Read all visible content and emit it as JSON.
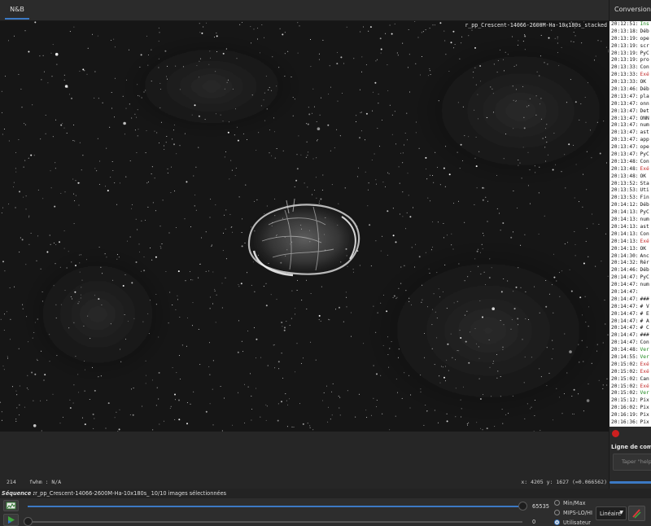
{
  "tabs": {
    "left_active": "N&B",
    "right_active": "Conversion"
  },
  "viewer": {
    "filename": "r_pp_Crescent-14066-2600M-Ha-10x180s_stacked"
  },
  "log": [
    {
      "time": "20:12:51:",
      "msg": "Ins",
      "color": "#1f8a1f"
    },
    {
      "time": "20:13:18:",
      "msg": "Déb",
      "color": "#111111"
    },
    {
      "time": "20:13:19:",
      "msg": "ope",
      "color": "#111111"
    },
    {
      "time": "20:13:19:",
      "msg": "scr",
      "color": "#111111"
    },
    {
      "time": "20:13:19:",
      "msg": "PyC",
      "color": "#111111"
    },
    {
      "time": "20:13:19:",
      "msg": "pro",
      "color": "#111111"
    },
    {
      "time": "20:13:33:",
      "msg": "Con",
      "color": "#111111"
    },
    {
      "time": "20:13:33:",
      "msg": "Exé",
      "color": "#c22a2a"
    },
    {
      "time": "20:13:33:",
      "msg": "OK",
      "color": "#111111"
    },
    {
      "time": "20:13:46:",
      "msg": "Déb",
      "color": "#111111"
    },
    {
      "time": "20:13:47:",
      "msg": "pla",
      "color": "#111111"
    },
    {
      "time": "20:13:47:",
      "msg": "onn",
      "color": "#111111"
    },
    {
      "time": "20:13:47:",
      "msg": "Det",
      "color": "#111111"
    },
    {
      "time": "20:13:47:",
      "msg": "ONN",
      "color": "#111111"
    },
    {
      "time": "20:13:47:",
      "msg": "num",
      "color": "#111111"
    },
    {
      "time": "20:13:47:",
      "msg": "ast",
      "color": "#111111"
    },
    {
      "time": "20:13:47:",
      "msg": "app",
      "color": "#111111"
    },
    {
      "time": "20:13:47:",
      "msg": "ope",
      "color": "#111111"
    },
    {
      "time": "20:13:47:",
      "msg": "PyC",
      "color": "#111111"
    },
    {
      "time": "20:13:48:",
      "msg": "Con",
      "color": "#111111"
    },
    {
      "time": "20:13:48:",
      "msg": "Exé",
      "color": "#c22a2a"
    },
    {
      "time": "20:13:48:",
      "msg": "OK",
      "color": "#111111"
    },
    {
      "time": "20:13:52:",
      "msg": "Sta",
      "color": "#111111"
    },
    {
      "time": "20:13:53:",
      "msg": "Uti",
      "color": "#111111"
    },
    {
      "time": "20:13:53:",
      "msg": "Fin",
      "color": "#111111"
    },
    {
      "time": "20:14:12:",
      "msg": "Déb",
      "color": "#111111"
    },
    {
      "time": "20:14:13:",
      "msg": "PyC",
      "color": "#111111"
    },
    {
      "time": "20:14:13:",
      "msg": "num",
      "color": "#111111"
    },
    {
      "time": "20:14:13:",
      "msg": "ast",
      "color": "#111111"
    },
    {
      "time": "20:14:13:",
      "msg": "Con",
      "color": "#111111"
    },
    {
      "time": "20:14:13:",
      "msg": "Exé",
      "color": "#c22a2a"
    },
    {
      "time": "20:14:13:",
      "msg": "OK",
      "color": "#111111"
    },
    {
      "time": "20:14:30:",
      "msg": "Anc",
      "color": "#111111"
    },
    {
      "time": "20:14:32:",
      "msg": "Rér",
      "color": "#111111"
    },
    {
      "time": "20:14:46:",
      "msg": "Déb",
      "color": "#111111"
    },
    {
      "time": "20:14:47:",
      "msg": "PyC",
      "color": "#111111"
    },
    {
      "time": "20:14:47:",
      "msg": "num",
      "color": "#111111"
    },
    {
      "time": "20:14:47:",
      "msg": "",
      "color": "#111111"
    },
    {
      "time": "20:14:47:",
      "msg": "###",
      "color": "#111111"
    },
    {
      "time": "20:14:47:",
      "msg": "# V",
      "color": "#111111"
    },
    {
      "time": "20:14:47:",
      "msg": "# E",
      "color": "#111111"
    },
    {
      "time": "20:14:47:",
      "msg": "# A",
      "color": "#111111"
    },
    {
      "time": "20:14:47:",
      "msg": "# C",
      "color": "#111111"
    },
    {
      "time": "20:14:47:",
      "msg": "###",
      "color": "#111111"
    },
    {
      "time": "20:14:47:",
      "msg": "Con",
      "color": "#111111"
    },
    {
      "time": "20:14:48:",
      "msg": "Ver",
      "color": "#1f8a1f"
    },
    {
      "time": "20:14:55:",
      "msg": "Ver",
      "color": "#1f8a1f"
    },
    {
      "time": "20:15:02:",
      "msg": "Exé",
      "color": "#c22a2a"
    },
    {
      "time": "20:15:02:",
      "msg": "Exé",
      "color": "#c22a2a"
    },
    {
      "time": "20:15:02:",
      "msg": "Can",
      "color": "#111111"
    },
    {
      "time": "20:15:02:",
      "msg": "Exé",
      "color": "#c22a2a"
    },
    {
      "time": "20:15:02:",
      "msg": "Ver",
      "color": "#1f8a1f"
    },
    {
      "time": "20:15:12:",
      "msg": "Pix",
      "color": "#111111"
    },
    {
      "time": "20:16:02:",
      "msg": "Pix",
      "color": "#111111"
    },
    {
      "time": "20:16:19:",
      "msg": "Pix",
      "color": "#111111"
    },
    {
      "time": "20:16:36:",
      "msg": "Pix",
      "color": "#111111"
    }
  ],
  "command": {
    "label": "Ligne de comma",
    "placeholder": "Taper \"help\""
  },
  "info": {
    "count": "214",
    "fwhm": "fwhm : N/A",
    "coords": "x: 4205 y: 1627 (=0.066562)"
  },
  "sequence": {
    "label": "Séquence :",
    "text": "r_pp_Crescent-14066-2600M-Ha-10x180s_ 10/10 images sélectionnées"
  },
  "sliders": {
    "hi_value": "65535",
    "lo_value": "0"
  },
  "modes": {
    "minmax": "Min/Max",
    "mips": "MIPS-LO/HI",
    "user": "Utilisateur",
    "selected": "user"
  },
  "scale": {
    "selected": "Linéaire"
  },
  "colors": {
    "accent": "#3c79c4",
    "error": "#c22a2a",
    "success": "#1f8a1f",
    "record": "#cc1f1f"
  },
  "icons": {
    "histogram": "histogram-icon",
    "play": "play-icon",
    "color": "color-picker-icon",
    "dropdown": "chevron-down-icon"
  }
}
